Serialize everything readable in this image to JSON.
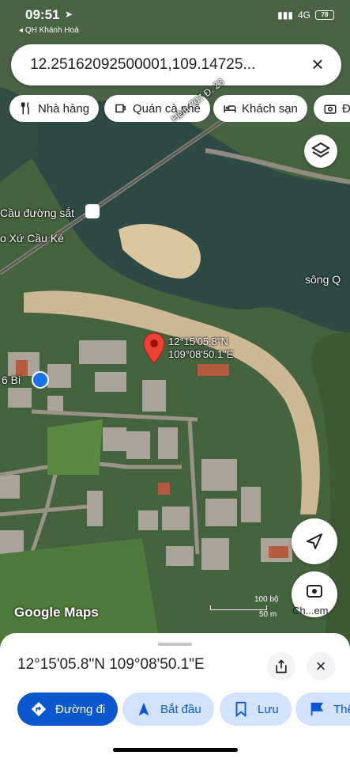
{
  "status_bar": {
    "time": "09:51",
    "carrier": "QH Khánh Hoà",
    "battery": "78"
  },
  "search": {
    "query": "12.25162092500001,109.14725..."
  },
  "chips": [
    {
      "label": "Nhà hàng",
      "icon": "fork-knife-icon"
    },
    {
      "label": "Quán cà phê",
      "icon": "coffee-icon"
    },
    {
      "label": "Khách sạn",
      "icon": "bed-icon"
    },
    {
      "label": "Đị",
      "icon": "camera-icon"
    }
  ],
  "map": {
    "labels": {
      "road": "Hẻm 707 Đ. 23",
      "bridge": "Cầu đường sắt",
      "church": "o Xứ Cầu Ké",
      "river": "sông Q",
      "shop": "6 Bi",
      "watermark": "Google Maps"
    },
    "pin": {
      "lat": "12°15'05.8\"N",
      "lng": "109°08'50.1\"E"
    },
    "scale": {
      "text1": "100 bộ",
      "text2": "50 m"
    },
    "street_view_label": "Ch...em"
  },
  "sheet": {
    "title": "12°15'05.8\"N 109°08'50.1\"E",
    "actions": [
      {
        "label": "Đường đi",
        "icon": "directions-icon"
      },
      {
        "label": "Bắt đầu",
        "icon": "navigation-arrow-icon"
      },
      {
        "label": "Lưu",
        "icon": "bookmark-icon"
      },
      {
        "label": "Thê",
        "icon": "flag-icon"
      }
    ]
  }
}
